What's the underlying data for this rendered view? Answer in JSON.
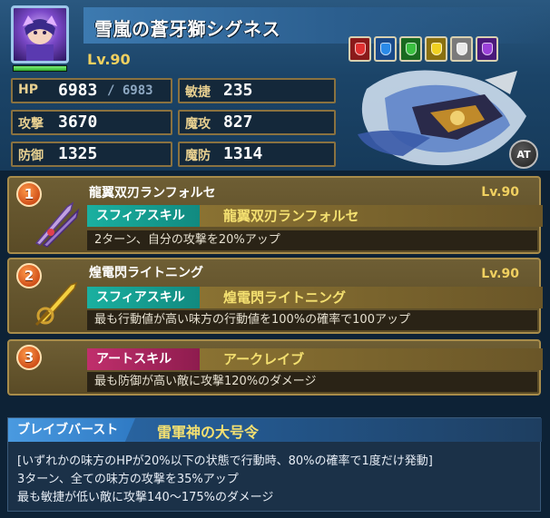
{
  "unit": {
    "name": "雪嵐の蒼牙獅シグネス",
    "level": "Lv.90",
    "hp_fill": 1.0
  },
  "stats": {
    "hp_label": "HP",
    "hp_value": "6983",
    "hp_max": "/ 6983",
    "agi_label": "敏捷",
    "agi_value": "235",
    "atk_label": "攻撃",
    "atk_value": "3670",
    "matk_label": "魔攻",
    "matk_value": "827",
    "def_label": "防御",
    "def_value": "1325",
    "mdef_label": "魔防",
    "mdef_value": "1314"
  },
  "elements": [
    {
      "name": "fire",
      "color": "#e03030",
      "frame": "#8a1a1a"
    },
    {
      "name": "water",
      "color": "#2a8ae8",
      "frame": "#1a4a8a"
    },
    {
      "name": "earth",
      "color": "#3ac040",
      "frame": "#1a6a20"
    },
    {
      "name": "thunder",
      "color": "#f0d020",
      "frame": "#8a7010"
    },
    {
      "name": "light",
      "color": "#e8e8e8",
      "frame": "#7a7a7a"
    },
    {
      "name": "dark",
      "color": "#9a40d8",
      "frame": "#4a1a7a"
    }
  ],
  "at_badge": "AT",
  "skills": [
    {
      "number": "1",
      "title": "龍翼双刃ランフォルセ",
      "level": "Lv.90",
      "tag": "スフィアスキル",
      "tag_name": "龍翼双刃ランフォルセ",
      "desc": "2ターン、自分の攻撃を20%アップ"
    },
    {
      "number": "2",
      "title": "煌電閃ライトニング",
      "level": "Lv.90",
      "tag": "スフィアスキル",
      "tag_name": "煌電閃ライトニング",
      "desc": "最も行動値が高い味方の行動値を100%の確率で100アップ"
    },
    {
      "number": "3",
      "tag": "アートスキル",
      "tag_name": "アークレイブ",
      "desc": "最も防御が高い敵に攻撃120%のダメージ"
    }
  ],
  "brave_burst": {
    "label": "ブレイブバースト",
    "name": "雷軍神の大号令",
    "lines": [
      "[いずれかの味方のHPが20%以下の状態で行動時、80%の確率で1度だけ発動]",
      "3ターン、全ての味方の攻撃を35%アップ",
      "最も敏捷が低い敵に攻撃140～175%のダメージ"
    ]
  }
}
